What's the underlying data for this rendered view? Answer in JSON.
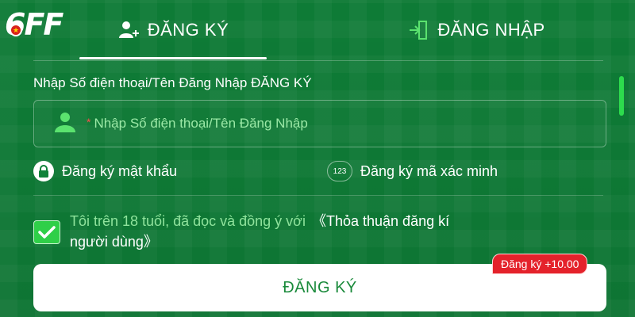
{
  "logo": {
    "text": "6FF",
    "flag_glyph": "★"
  },
  "tabs": [
    {
      "label": "ĐĂNG KÝ",
      "icon": "add-user-icon",
      "active": true
    },
    {
      "label": "ĐĂNG NHẬP",
      "icon": "login-icon",
      "active": false
    }
  ],
  "form": {
    "section_label": "Nhập Số điện thoại/Tên Đăng Nhập ĐĂNG KÝ",
    "username_required_mark": "*",
    "username_placeholder": "Nhập Số điện thoại/Tên Đăng Nhập",
    "options": [
      {
        "label": "Đăng ký mật khẩu",
        "icon": "lock-icon"
      },
      {
        "label": "Đăng ký mã xác minh",
        "icon": "code-123-icon",
        "icon_text": "123"
      }
    ],
    "consent_checked": true,
    "consent_text": "Tôi trên 18 tuổi, đã đọc và đồng ý với",
    "agreement_open": "《Thỏa thuận đăng kí",
    "agreement_close": "người dùng》",
    "submit_label": "ĐĂNG KÝ",
    "bonus_badge": "Đăng ký +10.00"
  },
  "colors": {
    "background": "#0f8239",
    "accent_green": "#2fcf48",
    "placeholder_green": "#9be8a6",
    "badge_red": "#e4222b",
    "button_text": "#1a8a3b"
  }
}
